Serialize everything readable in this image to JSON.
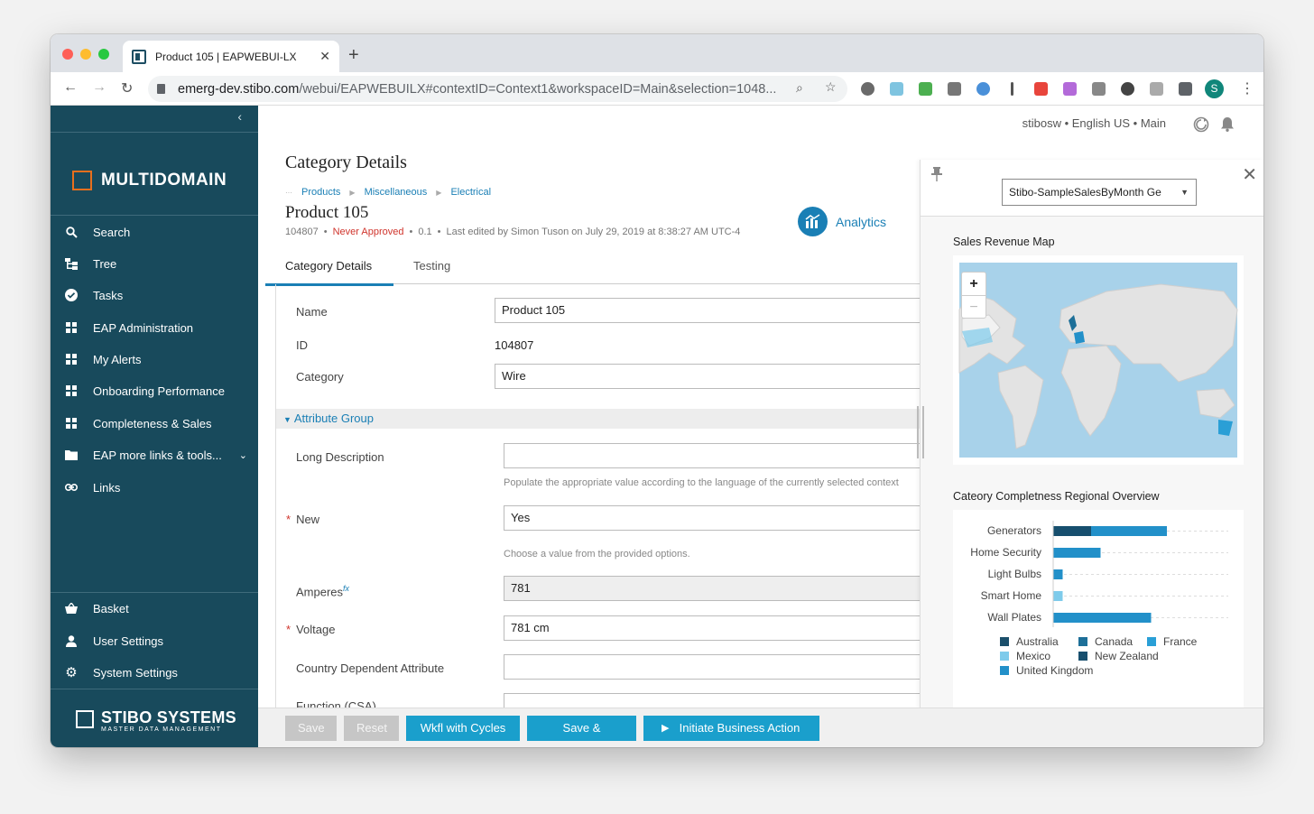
{
  "browser": {
    "tab_title": "Product 105 | EAPWEBUI-LX",
    "url_domain": "emerg-dev.stibo.com",
    "url_path": "/webui/EAPWEBUILX#contextID=Context1&workspaceID=Main&selection=1048...",
    "profile_initial": "S"
  },
  "sidebar": {
    "logo": "MULTIDOMAIN",
    "items": [
      {
        "label": "Search",
        "icon": "search-icon"
      },
      {
        "label": "Tree",
        "icon": "tree-icon"
      },
      {
        "label": "Tasks",
        "icon": "check-circle-icon"
      },
      {
        "label": "EAP Administration",
        "icon": "dashboard-icon"
      },
      {
        "label": "My Alerts",
        "icon": "dashboard-icon"
      },
      {
        "label": "Onboarding Performance",
        "icon": "dashboard-icon"
      },
      {
        "label": "Completeness & Sales",
        "icon": "dashboard-icon"
      },
      {
        "label": "EAP more links & tools...",
        "icon": "folder-icon"
      },
      {
        "label": "Links",
        "icon": "link-icon"
      }
    ],
    "bottom": [
      {
        "label": "Basket",
        "icon": "basket-icon"
      },
      {
        "label": "User Settings",
        "icon": "user-icon"
      },
      {
        "label": "System Settings",
        "icon": "gear-icon"
      }
    ],
    "brand_name": "STIBO SYSTEMS",
    "brand_sub": "MASTER DATA MANAGEMENT"
  },
  "header": {
    "user_info": "stibosw • English US • Main"
  },
  "page": {
    "title": "Category Details",
    "breadcrumb": [
      "Products",
      "Miscellaneous",
      "Electrical"
    ],
    "product_name": "Product 105",
    "meta": {
      "id": "104807",
      "status": "Never Approved",
      "version": "0.1",
      "edited": "Last edited by Simon Tuson on July 29, 2019 at 8:38:27 AM UTC-4"
    },
    "analytics_label": "Analytics",
    "tabs": [
      "Category Details",
      "Testing"
    ]
  },
  "form": {
    "name_label": "Name",
    "name_value": "Product 105",
    "id_label": "ID",
    "id_value": "104807",
    "category_label": "Category",
    "category_value": "Wire",
    "group_label": "Attribute Group",
    "long_desc_label": "Long Description",
    "long_desc_value": "",
    "long_desc_help": "Populate the appropriate value according to the language of the currently selected context",
    "new_label": "New",
    "new_value": "Yes",
    "new_help": "Choose a value from the provided options.",
    "amperes_label": "Amperes",
    "amperes_fx": "fx",
    "amperes_value": "781",
    "voltage_label": "Voltage",
    "voltage_value": "781 cm",
    "country_label": "Country Dependent Attribute",
    "country_value": "",
    "function_label": "Function (CSA)"
  },
  "buttons": [
    "Save",
    "Reset",
    "Wkfl with Cycles",
    "Save & Approve",
    "Initiate Business Action"
  ],
  "panel": {
    "select_value": "Stibo-SampleSalesByMonth Ge",
    "map_title": "Sales Revenue Map",
    "zoom_in": "+",
    "zoom_out": "−",
    "chart_title": "Cateory Completness Regional Overview"
  },
  "chart_data": {
    "type": "bar",
    "orientation": "horizontal",
    "stacked": true,
    "title": "Cateory Completness Regional Overview",
    "categories": [
      "Generators",
      "Home Security",
      "Light Bulbs",
      "Smart Home",
      "Wall Plates"
    ],
    "legend_position": "bottom",
    "series": [
      {
        "name": "Australia",
        "color": "#1b4f6b",
        "values": [
          0,
          0,
          0,
          0,
          0
        ]
      },
      {
        "name": "Canada",
        "color": "#1d6f98",
        "values": [
          0,
          0,
          0,
          0,
          0
        ]
      },
      {
        "name": "France",
        "color": "#2a9fd6",
        "values": [
          0,
          0,
          0,
          0,
          0
        ]
      },
      {
        "name": "Mexico",
        "color": "#7ecbeb",
        "values": [
          0,
          0,
          0,
          0.15,
          0
        ]
      },
      {
        "name": "New Zealand",
        "color": "#174f6e",
        "values": [
          0.6,
          0,
          0,
          0,
          0
        ]
      },
      {
        "name": "United Kingdom",
        "color": "#2290c9",
        "values": [
          1.2,
          0.75,
          0.15,
          0,
          1.55
        ]
      }
    ]
  }
}
